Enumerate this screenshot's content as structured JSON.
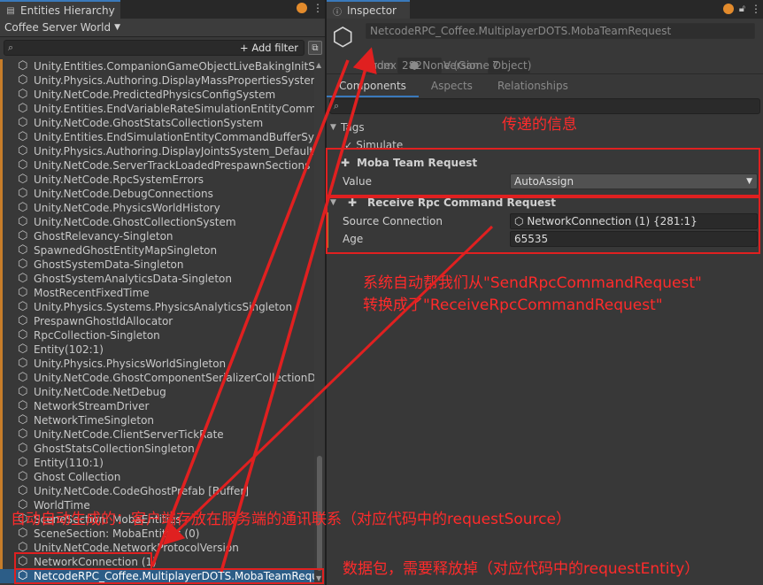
{
  "hierarchy": {
    "tab_title": "Entities Hierarchy",
    "world_selector": "Coffee Server World",
    "add_filter_label": "+ Add filter",
    "items": [
      {
        "label": "Unity.Entities.CompanionGameObjectLiveBakingInitSyst"
      },
      {
        "label": "Unity.Physics.Authoring.DisplayMassPropertiesSystem"
      },
      {
        "label": "Unity.NetCode.PredictedPhysicsConfigSystem"
      },
      {
        "label": "Unity.Entities.EndVariableRateSimulationEntityComman"
      },
      {
        "label": "Unity.NetCode.GhostStatsCollectionSystem"
      },
      {
        "label": "Unity.Entities.EndSimulationEntityCommandBufferSyste"
      },
      {
        "label": "Unity.Physics.Authoring.DisplayJointsSystem_Default"
      },
      {
        "label": "Unity.NetCode.ServerTrackLoadedPrespawnSections"
      },
      {
        "label": "Unity.NetCode.RpcSystemErrors"
      },
      {
        "label": "Unity.NetCode.DebugConnections"
      },
      {
        "label": "Unity.NetCode.PhysicsWorldHistory"
      },
      {
        "label": "Unity.NetCode.GhostCollectionSystem"
      },
      {
        "label": "GhostRelevancy-Singleton"
      },
      {
        "label": "SpawnedGhostEntityMapSingleton"
      },
      {
        "label": "GhostSystemData-Singleton"
      },
      {
        "label": "GhostSystemAnalyticsData-Singleton"
      },
      {
        "label": "MostRecentFixedTime"
      },
      {
        "label": "Unity.Physics.Systems.PhysicsAnalyticsSingleton"
      },
      {
        "label": "PrespawnGhostIdAllocator"
      },
      {
        "label": "RpcCollection-Singleton"
      },
      {
        "label": "Entity(102:1)"
      },
      {
        "label": "Unity.Physics.PhysicsWorldSingleton"
      },
      {
        "label": "Unity.NetCode.GhostComponentSerializerCollectionDat"
      },
      {
        "label": "Unity.NetCode.NetDebug"
      },
      {
        "label": "NetworkStreamDriver"
      },
      {
        "label": "NetworkTimeSingleton"
      },
      {
        "label": "Unity.NetCode.ClientServerTickRate"
      },
      {
        "label": "GhostStatsCollectionSingleton"
      },
      {
        "label": "Entity(110:1)"
      },
      {
        "label": "Ghost Collection"
      },
      {
        "label": "Unity.NetCode.CodeGhostPrefab [Buffer]"
      },
      {
        "label": "WorldTime"
      },
      {
        "label": "SceneSection: MobaEntities"
      },
      {
        "label": "SceneSection: MobaEntities (0)"
      },
      {
        "label": "Unity.NetCode.NetworkProtocolVersion"
      },
      {
        "label": "NetworkConnection (1)"
      },
      {
        "label": "NetcodeRPC_Coffee.MultiplayerDOTS.MobaTeamReque"
      }
    ]
  },
  "inspector": {
    "tab_title": "Inspector",
    "entity_name": "NetcodeRPC_Coffee.MultiplayerDOTS.MobaTeamRequest",
    "index_label": "Index",
    "index_value": "282",
    "version_label": "Version",
    "version_value": "7",
    "from_label": "From",
    "from_value": "None (Game Object)",
    "tabs": [
      "Components",
      "Aspects",
      "Relationships"
    ],
    "tags_label": "Tags",
    "simulate_label": "Simulate",
    "components": [
      {
        "title": "Moba Team Request",
        "fields": [
          {
            "key": "Value",
            "value": "AutoAssign"
          }
        ]
      },
      {
        "title": "Receive Rpc Command Request",
        "fields": [
          {
            "key": "Source Connection",
            "value": "NetworkConnection (1) {281:1}"
          },
          {
            "key": "Age",
            "value": "65535"
          }
        ]
      }
    ]
  },
  "annotations": {
    "info": "传递的信息",
    "convert_line1": "系统自动帮我们从\"SendRpcCommandRequest\"",
    "convert_line2": "转换成了\"ReceiveRpcCommandRequest\"",
    "connection_note": "自动自动生成的：客户端存放在服务端的通讯联系（对应代码中的requestSource）",
    "packet_note": "数据包，需要释放掉（对应代码中的requestEntity）"
  },
  "colors": {
    "accent": "#3a79bb",
    "annotation": "#e02020",
    "selection": "#2c5d87"
  }
}
